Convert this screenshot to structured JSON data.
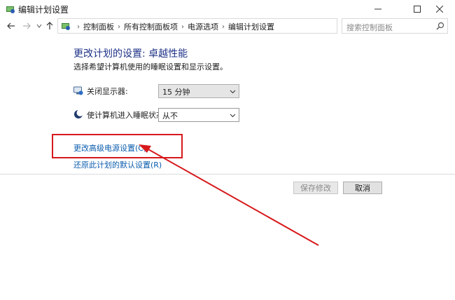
{
  "window": {
    "title": "编辑计划设置",
    "controls": {
      "minimize": "minimize",
      "maximize": "maximize",
      "close": "close"
    }
  },
  "address_bar": {
    "breadcrumbs": [
      "控制面板",
      "所有控制面板项",
      "电源选项",
      "编辑计划设置"
    ]
  },
  "search": {
    "placeholder": "搜索控制面板"
  },
  "content": {
    "heading": "更改计划的设置: 卓越性能",
    "subheading": "选择希望计算机使用的睡眠设置和显示设置。",
    "settings": [
      {
        "label": "关闭显示器:",
        "value": "15 分钟",
        "icon": "monitor-icon"
      },
      {
        "label": "使计算机进入睡眠状态:",
        "value": "从不",
        "icon": "sleep-moon-icon"
      }
    ],
    "links": {
      "advanced": "更改高级电源设置(C)",
      "restore": "还原此计划的默认设置(R)"
    }
  },
  "buttons": {
    "save": "保存修改",
    "cancel": "取消"
  },
  "colors": {
    "heading": "#1e3287",
    "link": "#0b5cad",
    "annotation": "#d7191c"
  }
}
